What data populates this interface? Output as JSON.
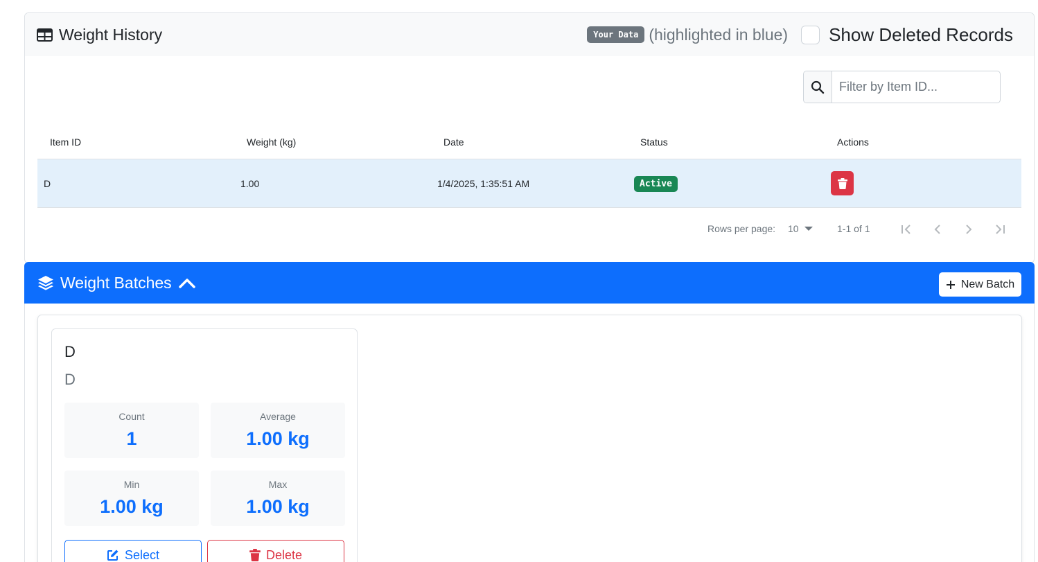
{
  "history": {
    "title": "Weight History",
    "your_data_badge": "Your Data",
    "highlight_note": "(highlighted in blue)",
    "show_deleted_label": "Show Deleted Records",
    "show_deleted_checked": false,
    "filter_placeholder": "Filter by Item ID...",
    "filter_value": "",
    "columns": [
      "Item ID",
      "Weight (kg)",
      "Date",
      "Status",
      "Actions"
    ],
    "rows": [
      {
        "item_id": "D",
        "weight": "1.00",
        "date": "1/4/2025, 1:35:51 AM",
        "status": "Active"
      }
    ],
    "pagination": {
      "rows_per_page_label": "Rows per page:",
      "rows_per_page_value": "10",
      "range": "1-1 of 1"
    }
  },
  "batches": {
    "title": "Weight Batches",
    "new_batch_label": "New Batch",
    "cards": [
      {
        "name": "D",
        "description": "D",
        "stats": {
          "count_label": "Count",
          "count_value": "1",
          "average_label": "Average",
          "average_value": "1.00 kg",
          "min_label": "Min",
          "min_value": "1.00 kg",
          "max_label": "Max",
          "max_value": "1.00 kg"
        },
        "select_label": "Select",
        "delete_label": "Delete"
      }
    ]
  },
  "colors": {
    "primary": "#0d6efd",
    "danger": "#dc3545",
    "success": "#198754",
    "secondary": "#6c757d",
    "row_highlight": "#e3f0fb"
  },
  "icons": {
    "history_title": "table-icon",
    "filter": "search-icon",
    "row_action": "trash-icon",
    "batches_title": "layers-icon",
    "batches_toggle": "chevron-up-icon",
    "new_batch": "plus-icon",
    "select": "edit-icon",
    "delete": "trash-icon"
  }
}
